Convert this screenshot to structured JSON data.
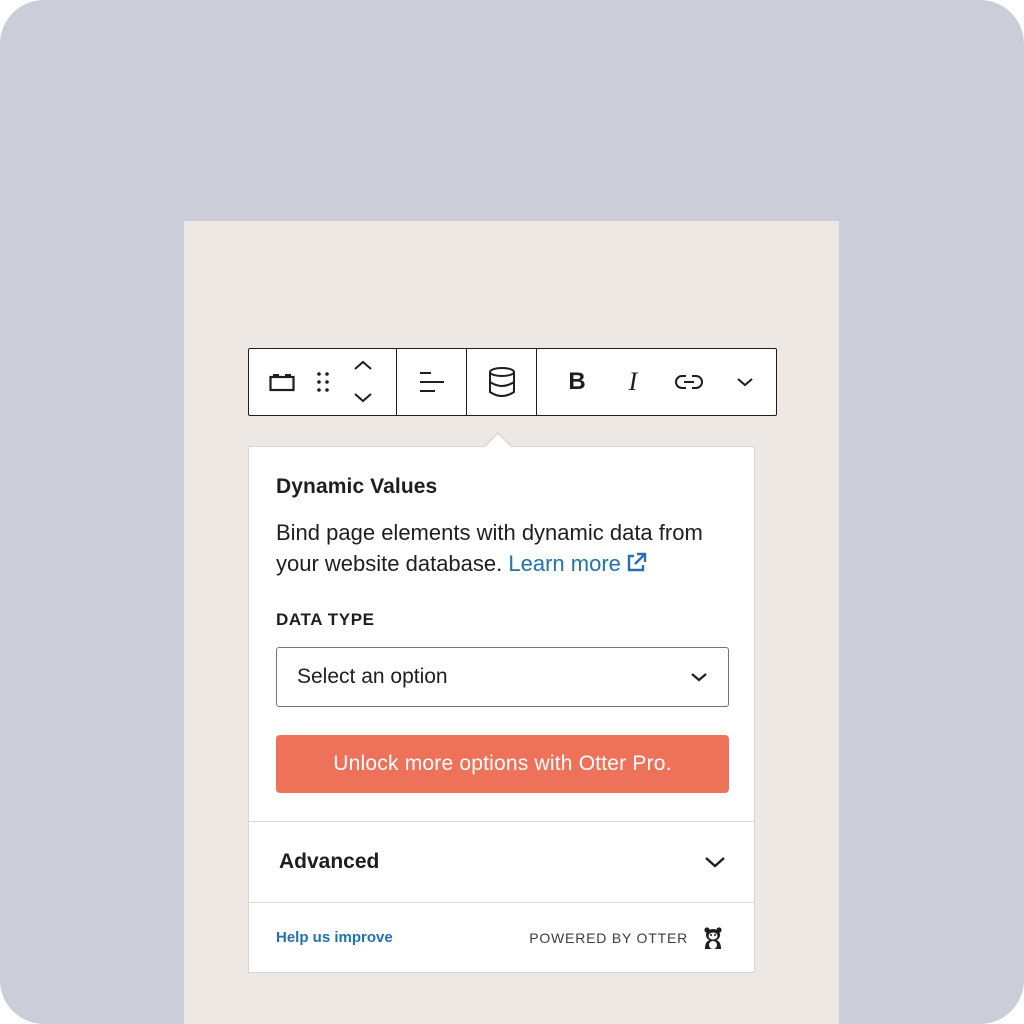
{
  "toolbar": {
    "buttons": [
      {
        "name": "block-type",
        "icon": "block-icon"
      },
      {
        "name": "drag",
        "icon": "drag-handle-icon"
      },
      {
        "name": "move",
        "icon": "move-up-down-icon"
      },
      {
        "name": "align",
        "icon": "align-left-icon"
      },
      {
        "name": "dynamic-data",
        "icon": "database-icon"
      },
      {
        "name": "bold",
        "label": "B"
      },
      {
        "name": "italic",
        "label": "I"
      },
      {
        "name": "link",
        "icon": "link-icon"
      },
      {
        "name": "more",
        "icon": "chevron-down-icon"
      }
    ],
    "bold_label": "B",
    "italic_label": "I"
  },
  "popover": {
    "title": "Dynamic Values",
    "description": "Bind page elements with dynamic data from your website database.",
    "learn_more": "Learn more",
    "data_type_label": "DATA TYPE",
    "select_value": "Select an option",
    "pro_button": "Unlock more options with Otter Pro.",
    "advanced_label": "Advanced",
    "help_link": "Help us improve",
    "powered_by": "POWERED BY OTTER"
  },
  "colors": {
    "background": "#cbced8",
    "canvas": "#ede8e4",
    "accent_link": "#2271b1",
    "pro_button": "#ee7259",
    "text": "#1e1e1e"
  }
}
